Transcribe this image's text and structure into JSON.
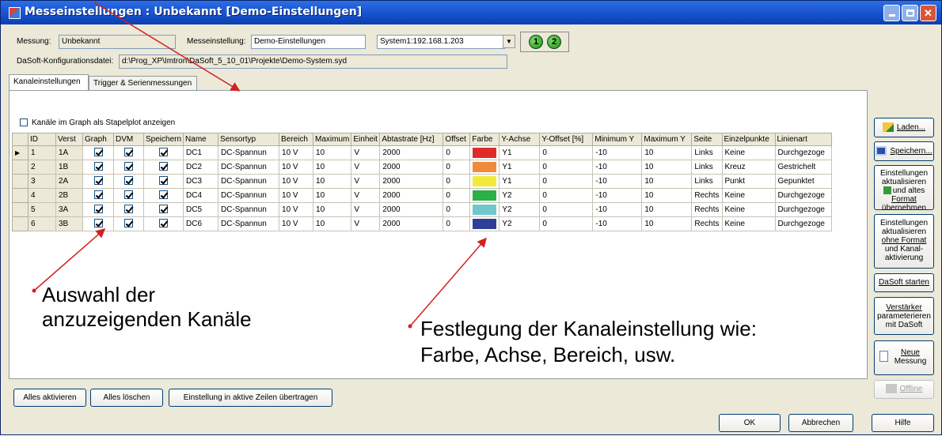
{
  "window": {
    "title": "Messeinstellungen : Unbekannt [Demo-Einstellungen]"
  },
  "header": {
    "messung_label": "Messung:",
    "messung_value": "Unbekannt",
    "messeinstellung_label": "Messeinstellung:",
    "messeinstellung_value": "Demo-Einstellungen",
    "system_value": "System1:192.168.1.203",
    "badge1": "1",
    "badge2": "2",
    "config_label": "DaSoft-Konfigurationsdatei:",
    "config_value": "d:\\Prog_XP\\Imtron\\DaSoft_5_10_01\\Projekte\\Demo-System.syd"
  },
  "tabs": [
    {
      "label": "Kanaleinstellungen"
    },
    {
      "label": "Trigger & Serienmessungen"
    }
  ],
  "stapel_checkbox_label": "Kanäle im Graph als Stapelplot anzeigen",
  "table": {
    "columns": [
      "ID",
      "Verst",
      "Graph",
      "DVM",
      "Speichern",
      "Name",
      "Sensortyp",
      "Bereich",
      "Maximum",
      "Einheit",
      "Abtastrate [Hz]",
      "Offset",
      "Farbe",
      "Y-Achse",
      "Y-Offset [%]",
      "Minimum Y",
      "Maximum Y",
      "Seite",
      "Einzelpunkte",
      "Linienart"
    ],
    "rows": [
      {
        "id": "1",
        "verst": "1A",
        "name": "DC1",
        "sensortyp": "DC-Spannun",
        "bereich": "10 V",
        "maximum": "10",
        "einheit": "V",
        "abtastrate": "2000",
        "offset": "0",
        "farbe": "#e02a2a",
        "yachse": "Y1",
        "yoffset": "0",
        "miny": "-10",
        "maxy": "10",
        "seite": "Links",
        "einzelpunkte": "Keine",
        "linienart": "Durchgezoge"
      },
      {
        "id": "2",
        "verst": "1B",
        "name": "DC2",
        "sensortyp": "DC-Spannun",
        "bereich": "10 V",
        "maximum": "10",
        "einheit": "V",
        "abtastrate": "2000",
        "offset": "0",
        "farbe": "#f08a3c",
        "yachse": "Y1",
        "yoffset": "0",
        "miny": "-10",
        "maxy": "10",
        "seite": "Links",
        "einzelpunkte": "Kreuz",
        "linienart": "Gestrichelt"
      },
      {
        "id": "3",
        "verst": "2A",
        "name": "DC3",
        "sensortyp": "DC-Spannun",
        "bereich": "10 V",
        "maximum": "10",
        "einheit": "V",
        "abtastrate": "2000",
        "offset": "0",
        "farbe": "#f2ea3a",
        "yachse": "Y1",
        "yoffset": "0",
        "miny": "-10",
        "maxy": "10",
        "seite": "Links",
        "einzelpunkte": "Punkt",
        "linienart": "Gepunktet"
      },
      {
        "id": "4",
        "verst": "2B",
        "name": "DC4",
        "sensortyp": "DC-Spannun",
        "bereich": "10 V",
        "maximum": "10",
        "einheit": "V",
        "abtastrate": "2000",
        "offset": "0",
        "farbe": "#2bb04a",
        "yachse": "Y2",
        "yoffset": "0",
        "miny": "-10",
        "maxy": "10",
        "seite": "Rechts",
        "einzelpunkte": "Keine",
        "linienart": "Durchgezoge"
      },
      {
        "id": "5",
        "verst": "3A",
        "name": "DC5",
        "sensortyp": "DC-Spannun",
        "bereich": "10 V",
        "maximum": "10",
        "einheit": "V",
        "abtastrate": "2000",
        "offset": "0",
        "farbe": "#6fc8cc",
        "yachse": "Y2",
        "yoffset": "0",
        "miny": "-10",
        "maxy": "10",
        "seite": "Rechts",
        "einzelpunkte": "Keine",
        "linienart": "Durchgezoge"
      },
      {
        "id": "6",
        "verst": "3B",
        "name": "DC6",
        "sensortyp": "DC-Spannun",
        "bereich": "10 V",
        "maximum": "10",
        "einheit": "V",
        "abtastrate": "2000",
        "offset": "0",
        "farbe": "#2f3f98",
        "yachse": "Y2",
        "yoffset": "0",
        "miny": "-10",
        "maxy": "10",
        "seite": "Rechts",
        "einzelpunkte": "Keine",
        "linienart": "Durchgezoge"
      }
    ]
  },
  "annotations": {
    "left_line1": "Auswahl der",
    "left_line2": "anzuzeigenden Kanäle",
    "right_line1": "Festlegung der Kanaleinstellung wie:",
    "right_line2": "Farbe, Achse, Bereich, usw."
  },
  "side_buttons": {
    "laden": "Laden...",
    "speichern": "Speichern...",
    "akt_format_1": "Einstellungen",
    "akt_format_2": "aktualisieren",
    "akt_format_3": "und altes",
    "akt_format_4": "Format",
    "akt_format_5": "übernehmen",
    "akt_ohne_1": "Einstellungen",
    "akt_ohne_2": "aktualisieren",
    "akt_ohne_3": "ohne Format",
    "akt_ohne_4": "und Kanal-",
    "akt_ohne_5": "aktivierung",
    "dasoft_starten": "DaSoft starten",
    "verst_1": "Verstärker",
    "verst_2": "parameterieren",
    "verst_3": "mit DaSoft",
    "neue_1": "Neue",
    "neue_2": "Messung",
    "offline": "Offline"
  },
  "bottom_buttons": {
    "alles_aktivieren": "Alles aktivieren",
    "alles_loeschen": "Alles löschen",
    "uebertragen": "Einstellung in aktive Zeilen übertragen"
  },
  "footer_buttons": {
    "ok": "OK",
    "abbrechen": "Abbrechen",
    "hilfe": "Hilfe"
  },
  "colors": {
    "annotation_arrow": "#d42020",
    "title_bar": "#1b56d4"
  }
}
